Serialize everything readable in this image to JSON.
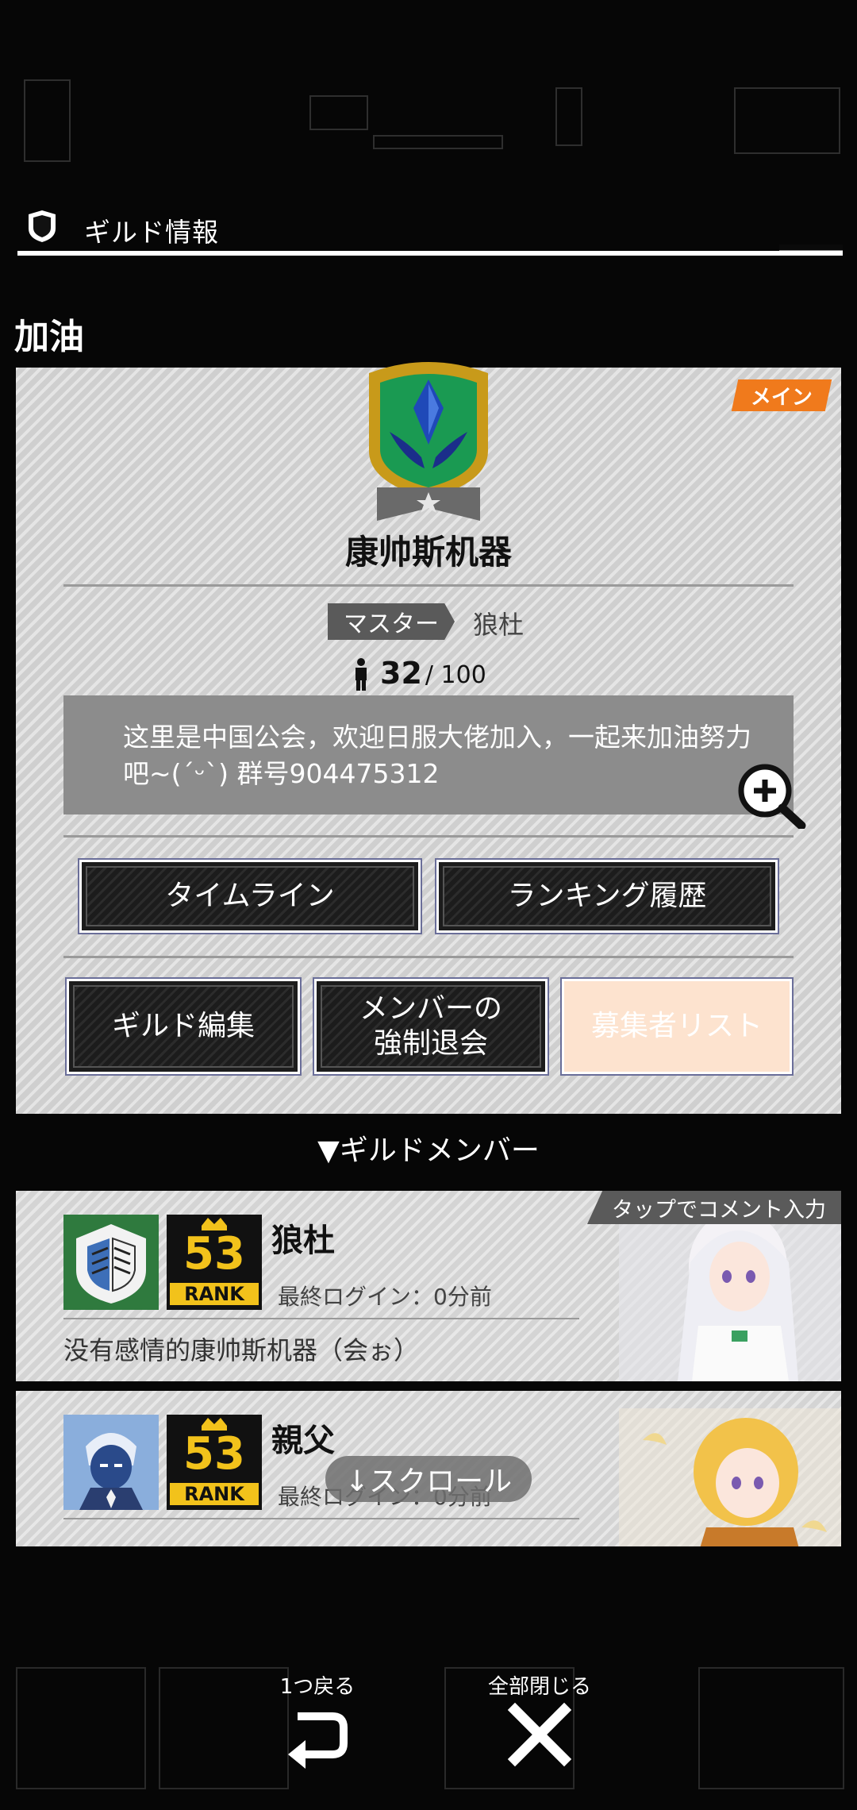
{
  "header": {
    "title": "ギルド情報"
  },
  "guild": {
    "heading": "加油",
    "badge": "メイン",
    "name": "康帅斯机器",
    "master_label": "マスター",
    "master_name": "狼杜",
    "member_count": "32",
    "member_max": "/ 100",
    "description": "这里是中国公会，欢迎日服大佬加入，一起来加油努力吧~(´ᵕ`) 群号904475312"
  },
  "buttons": {
    "timeline": "タイムライン",
    "ranking_history": "ランキング履歴",
    "guild_edit": "ギルド編集",
    "force_leave_1": "メンバーの",
    "force_leave_2": "強制退会",
    "applicant_list": "募集者リスト"
  },
  "members_section": {
    "heading": "▼ギルドメンバー"
  },
  "members": [
    {
      "name": "狼杜",
      "rank": "53",
      "rank_label": "RANK",
      "last_login": "最終ログイン：0分前",
      "comment": "没有感情的康帅斯机器（会ぉ）",
      "tab": "タップでコメント入力"
    },
    {
      "name": "親父",
      "rank": "53",
      "rank_label": "RANK",
      "last_login": "最終ログイン：0分前"
    }
  ],
  "scroll_hint": "↓スクロール",
  "bottom_nav": {
    "back": "1つ戻る",
    "close_all": "全部閉じる"
  },
  "colors": {
    "accent_orange": "#f07a1c",
    "emblem_gold": "#c89a1a",
    "emblem_green": "#1a9a52",
    "panel": "#cfcfcf"
  }
}
